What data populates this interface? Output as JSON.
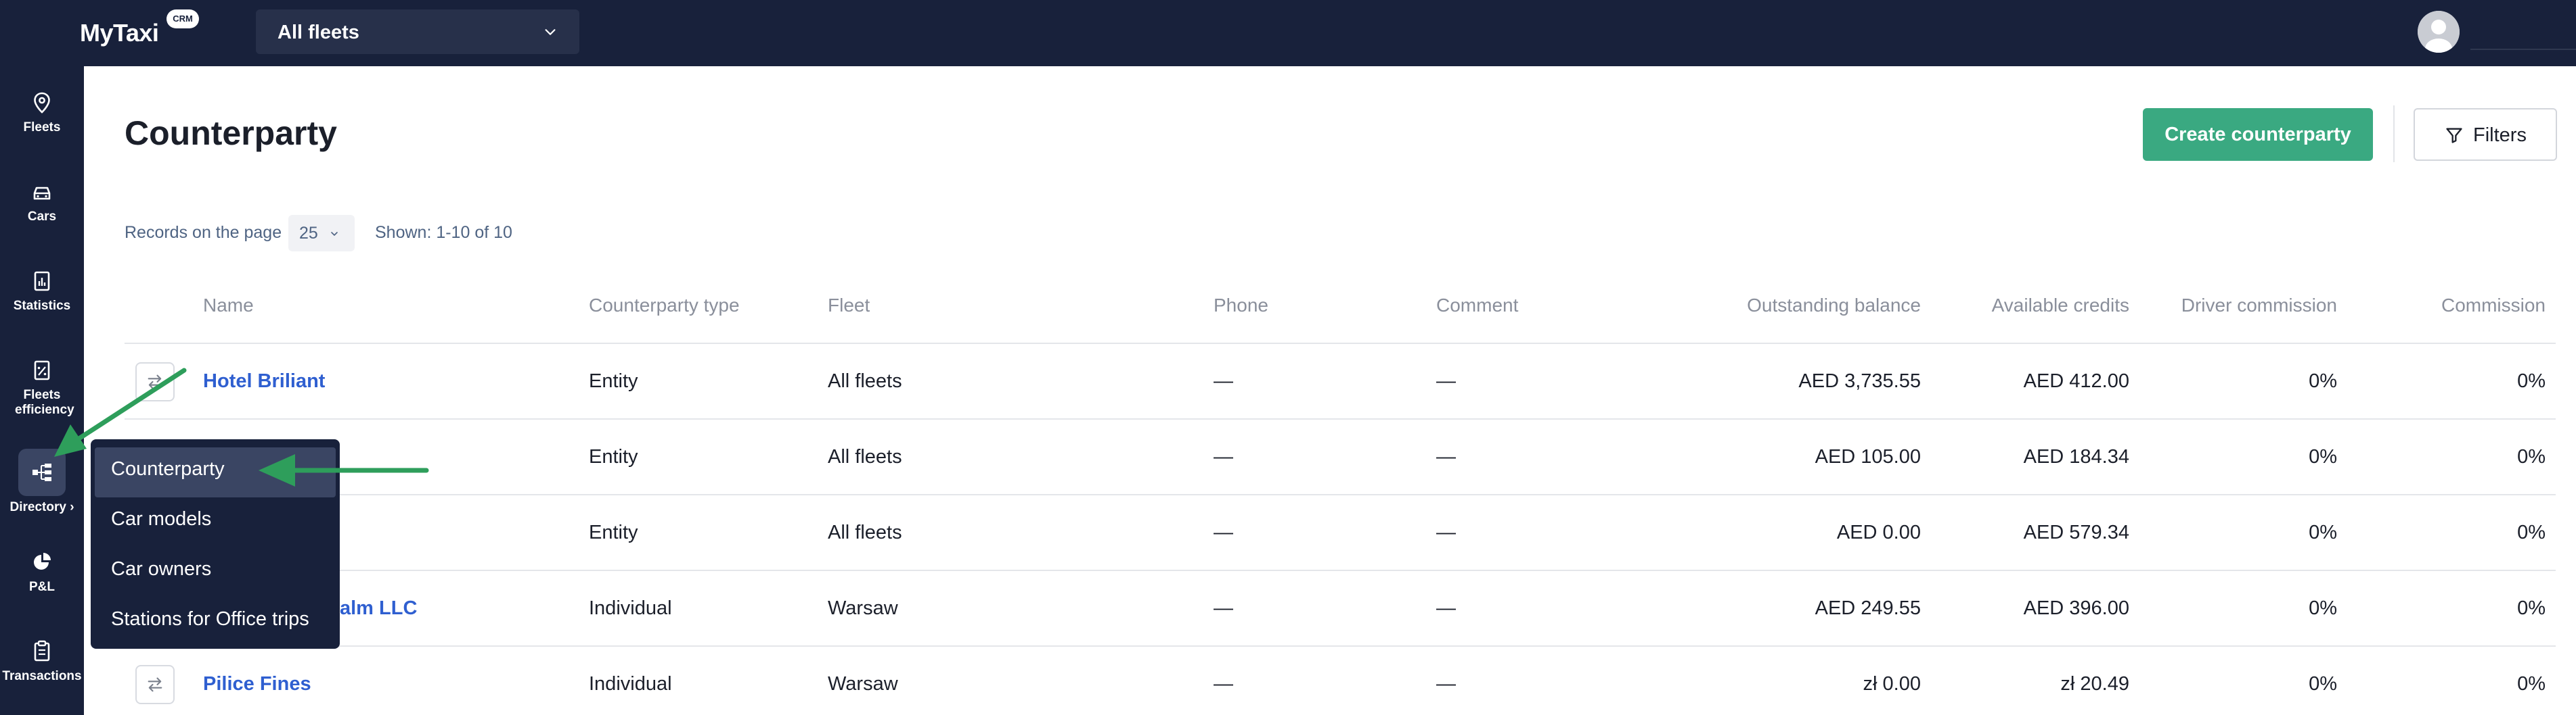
{
  "app": {
    "logo": "MyTaxi",
    "logo_badge": "CRM",
    "fleet_selector": "All fleets"
  },
  "sidebar": {
    "items": [
      {
        "label": "Fleets",
        "icon": "map-pin-icon"
      },
      {
        "label": "Cars",
        "icon": "car-icon"
      },
      {
        "label": "Statistics",
        "icon": "statistics-icon"
      },
      {
        "label": "Fleets efficiency",
        "icon": "efficiency-icon"
      },
      {
        "label": "Directory",
        "icon": "directory-icon",
        "active": true
      },
      {
        "label": "P&L",
        "icon": "pie-chart-icon"
      },
      {
        "label": "Transactions",
        "icon": "clipboard-icon"
      }
    ]
  },
  "directory_menu": {
    "items": [
      {
        "label": "Counterparty",
        "active": true
      },
      {
        "label": "Car models"
      },
      {
        "label": "Car owners"
      },
      {
        "label": "Stations for Office trips"
      }
    ]
  },
  "page": {
    "title": "Counterparty",
    "create_button": "Create counterparty",
    "filters_button": "Filters",
    "records_label": "Records on the page",
    "records_value": "25",
    "shown_text": "Shown: 1-10 of 10"
  },
  "table": {
    "columns": [
      "Name",
      "Counterparty type",
      "Fleet",
      "Phone",
      "Comment",
      "Outstanding balance",
      "Available credits",
      "Driver commission",
      "Commission"
    ],
    "rows": [
      {
        "name": "Hotel Briliant",
        "type": "Entity",
        "fleet": "All fleets",
        "phone": "—",
        "comment": "—",
        "outstanding": "AED 3,735.55",
        "credits": "AED 412.00",
        "driver_commission": "0%",
        "commission": "0%"
      },
      {
        "name": "",
        "type": "Entity",
        "fleet": "All fleets",
        "phone": "—",
        "comment": "—",
        "outstanding": "AED 105.00",
        "credits": "AED 184.34",
        "driver_commission": "0%",
        "commission": "0%"
      },
      {
        "name": "",
        "type": "Entity",
        "fleet": "All fleets",
        "phone": "—",
        "comment": "—",
        "outstanding": "AED 0.00",
        "credits": "AED 579.34",
        "driver_commission": "0%",
        "commission": "0%"
      },
      {
        "name": "alm LLC",
        "type": "Individual",
        "fleet": "Warsaw",
        "phone": "—",
        "comment": "—",
        "outstanding": "AED 249.55",
        "credits": "AED 396.00",
        "driver_commission": "0%",
        "commission": "0%"
      },
      {
        "name": "Pilice Fines",
        "type": "Individual",
        "fleet": "Warsaw",
        "phone": "—",
        "comment": "—",
        "outstanding": "zł 0.00",
        "credits": "zł 20.49",
        "driver_commission": "0%",
        "commission": "0%"
      }
    ]
  },
  "colors": {
    "nav_bg": "#18213b",
    "accent_green": "#3aa981",
    "link_blue": "#2f5fd0",
    "annotation_arrow": "#2e9e5b"
  }
}
